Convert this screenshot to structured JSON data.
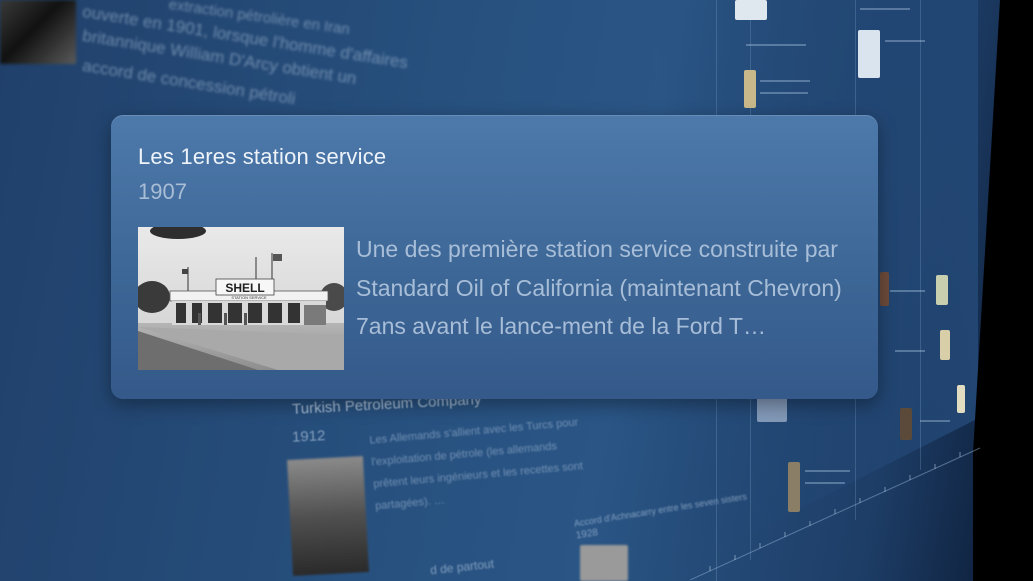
{
  "popup": {
    "title": "Les 1eres station service",
    "year": "1907",
    "description": "Une des première station service construite par Standard Oil of California (maintenant Chevron) 7ans avant le lance-ment de la Ford T…",
    "photo_sign": "SHELL",
    "photo_banner": "STATION SERVICE"
  },
  "background_card_top": {
    "lines": [
      "extraction pétrolière en Iran",
      "ouverte en 1901, lorsque l'homme d'affaires",
      "britannique William D'Arcy obtient un",
      "accord de concession pétroli"
    ]
  },
  "background_card_lower": {
    "title": "Turkish Petroleum Company",
    "year": "1912",
    "body": "Les Allemands s'allient avec les Turcs pour l'exploitation de pétrole (les allemands prêtent leurs ingénieurs et les recettes sont partagées). …"
  },
  "background_card_accord": {
    "title": "Accord d'Achnacarry entre les seven sisters",
    "year": "1928"
  },
  "background_partout": {
    "text": "d de partout"
  },
  "colors": {
    "popup_top": "#4d79ab",
    "popup_bottom": "#34598a",
    "title_text": "#eef3f9",
    "secondary_text": "#a8bed8",
    "background": "#27507e"
  }
}
